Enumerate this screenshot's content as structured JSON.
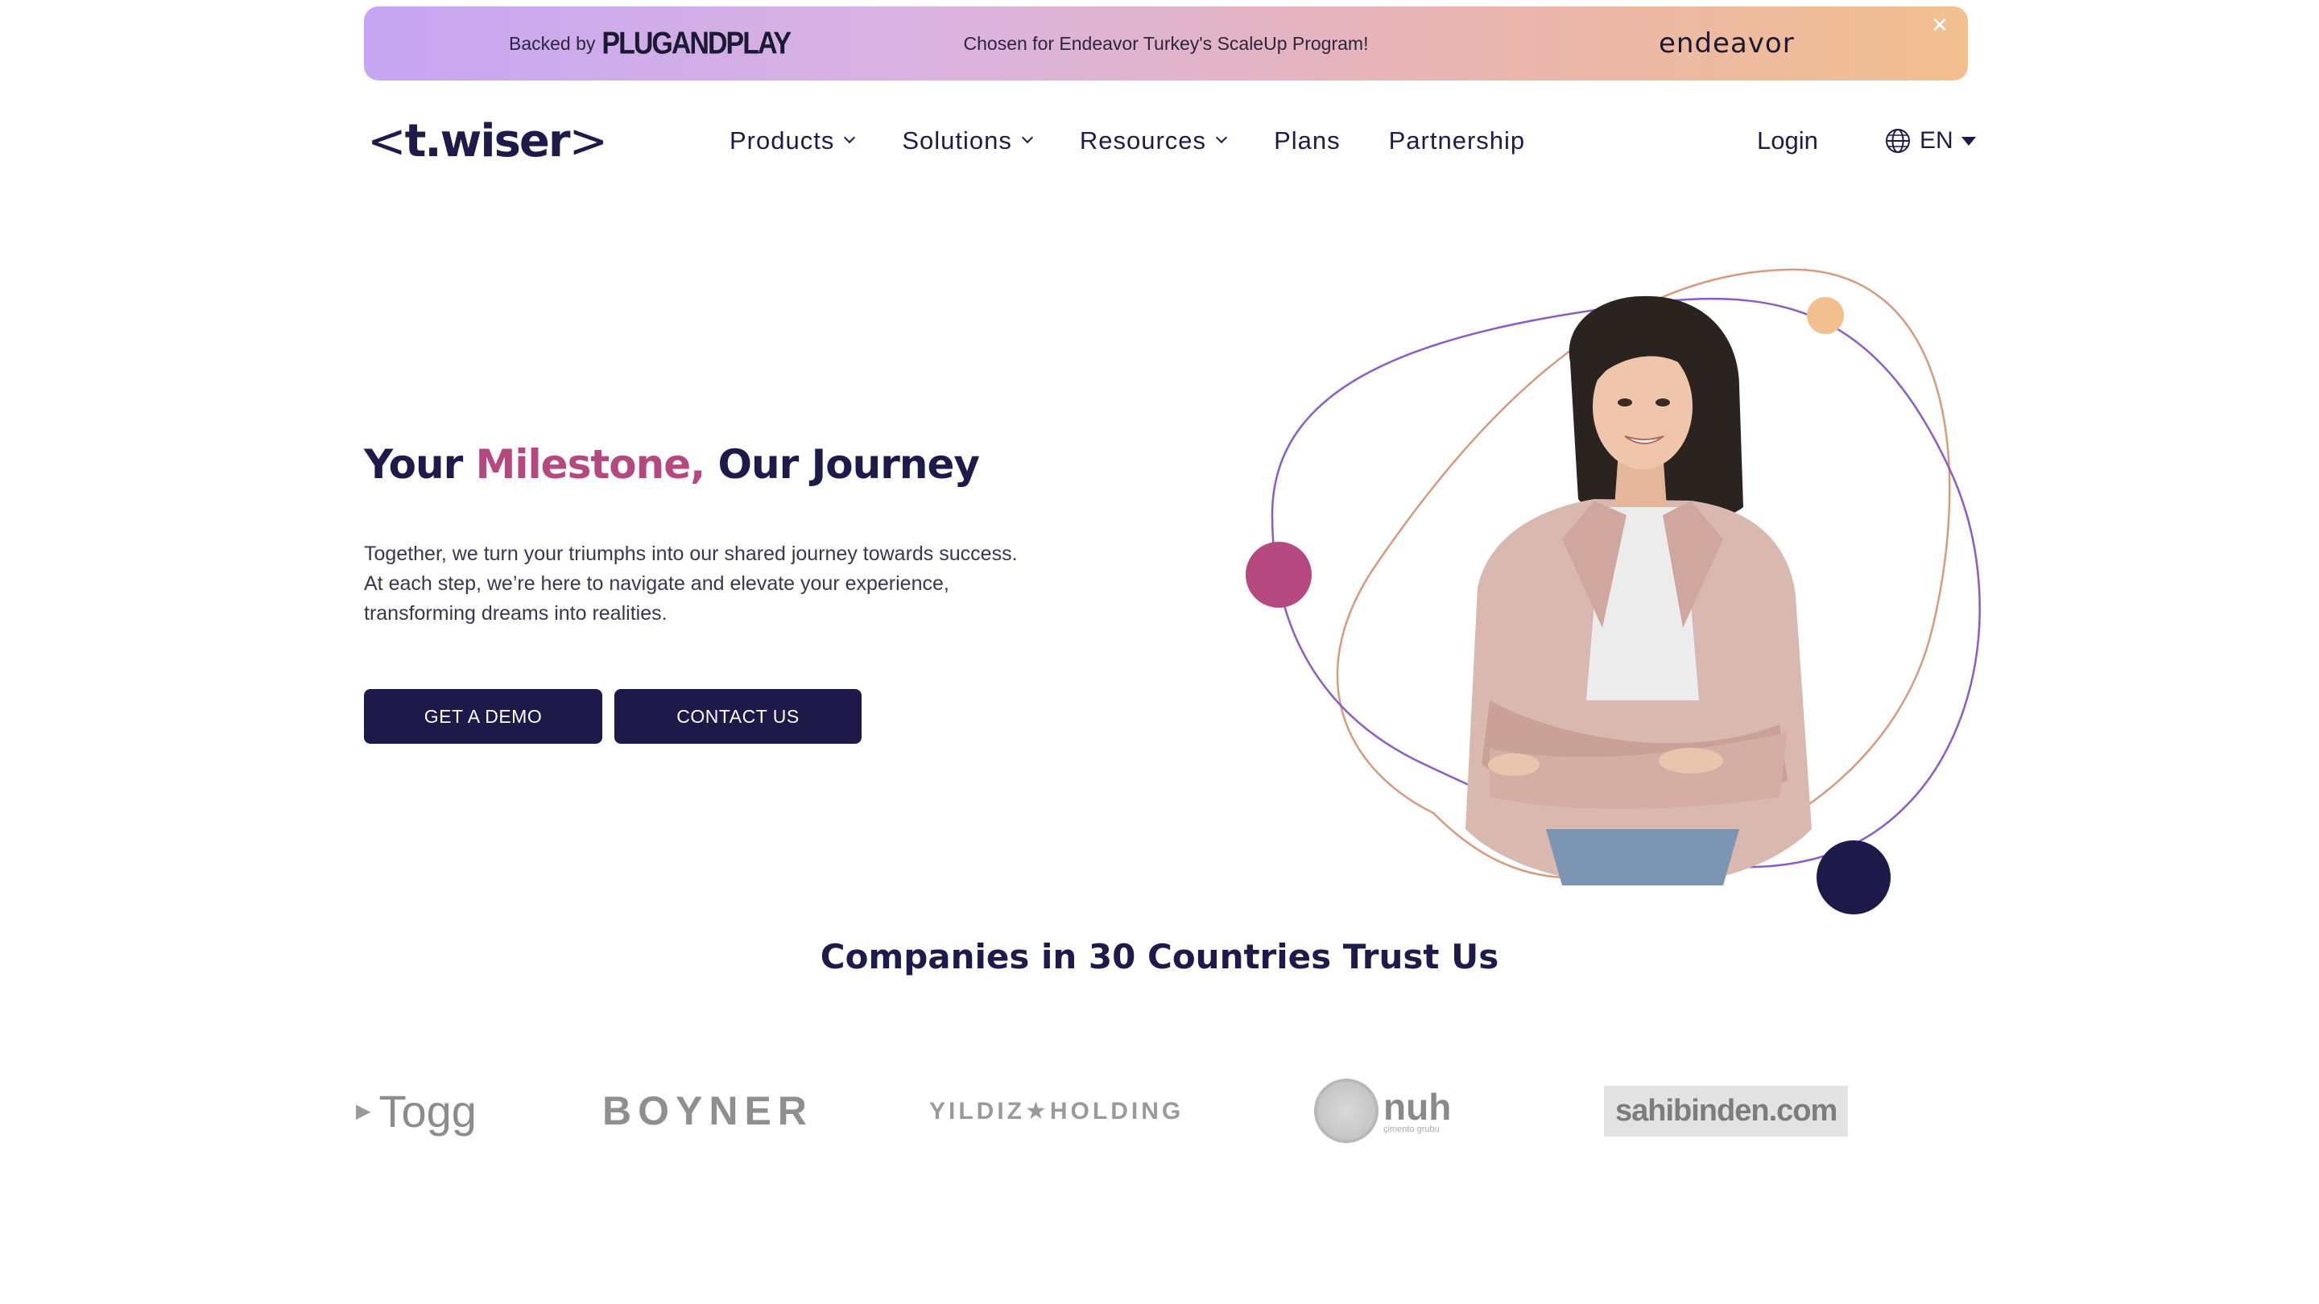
{
  "banner": {
    "backed_prefix": "Backed by",
    "backed_brand": "PLUGANDPLAY",
    "message": "Chosen for Endeavor Turkey's ScaleUp Program!",
    "partner": "endeavor",
    "close_icon": "close-icon"
  },
  "nav": {
    "logo_text": "t.wiser",
    "logo_left": "<",
    "logo_right": ">",
    "items": [
      {
        "label": "Products",
        "has_dropdown": true
      },
      {
        "label": "Solutions",
        "has_dropdown": true
      },
      {
        "label": "Resources",
        "has_dropdown": true
      },
      {
        "label": "Plans",
        "has_dropdown": false
      },
      {
        "label": "Partnership",
        "has_dropdown": false
      }
    ],
    "login": "Login",
    "language": "EN"
  },
  "hero": {
    "title_part1": "Your ",
    "title_accent": "Milestone,",
    "title_part2": " Our Journey",
    "body_line1": "Together, we turn your triumphs into our shared journey towards success.",
    "body_line2": "At each step, we’re here to navigate and elevate your experience,",
    "body_line3": "transforming dreams into realities.",
    "demo_button": "GET A DEMO",
    "contact_button": "CONTACT US"
  },
  "trust": {
    "title": "Companies in 30 Countries Trust Us",
    "logos": [
      "Togg",
      "BOYNER",
      "YILDIZ★HOLDING",
      "nuh",
      "sahibinden.com"
    ],
    "nuh_tagline": "çimento grubu"
  },
  "colors": {
    "primary": "#1e1b4b",
    "accent": "#b5487f",
    "orbit_purple": "#8a5cc9",
    "orbit_peach": "#d89a7e",
    "dot_peach": "#f2c08f"
  }
}
